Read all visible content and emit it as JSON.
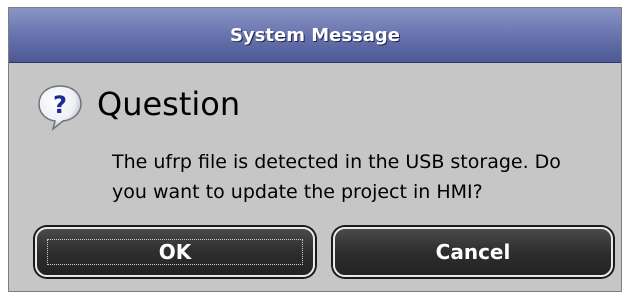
{
  "window": {
    "title": "System Message"
  },
  "dialog": {
    "icon": "question-icon",
    "heading": "Question",
    "message_lines": [
      "The ufrp file is detected in the USB storage. Do",
      "you want to update the project in HMI?"
    ]
  },
  "buttons": {
    "ok_label": "OK",
    "cancel_label": "Cancel"
  },
  "colors": {
    "titlebar": "#6b77b0",
    "dialog_bg": "#c6c6c6",
    "button_bg": "#2e2e2e",
    "button_text": "#ffffff",
    "icon_blue": "#1e2a9a"
  }
}
